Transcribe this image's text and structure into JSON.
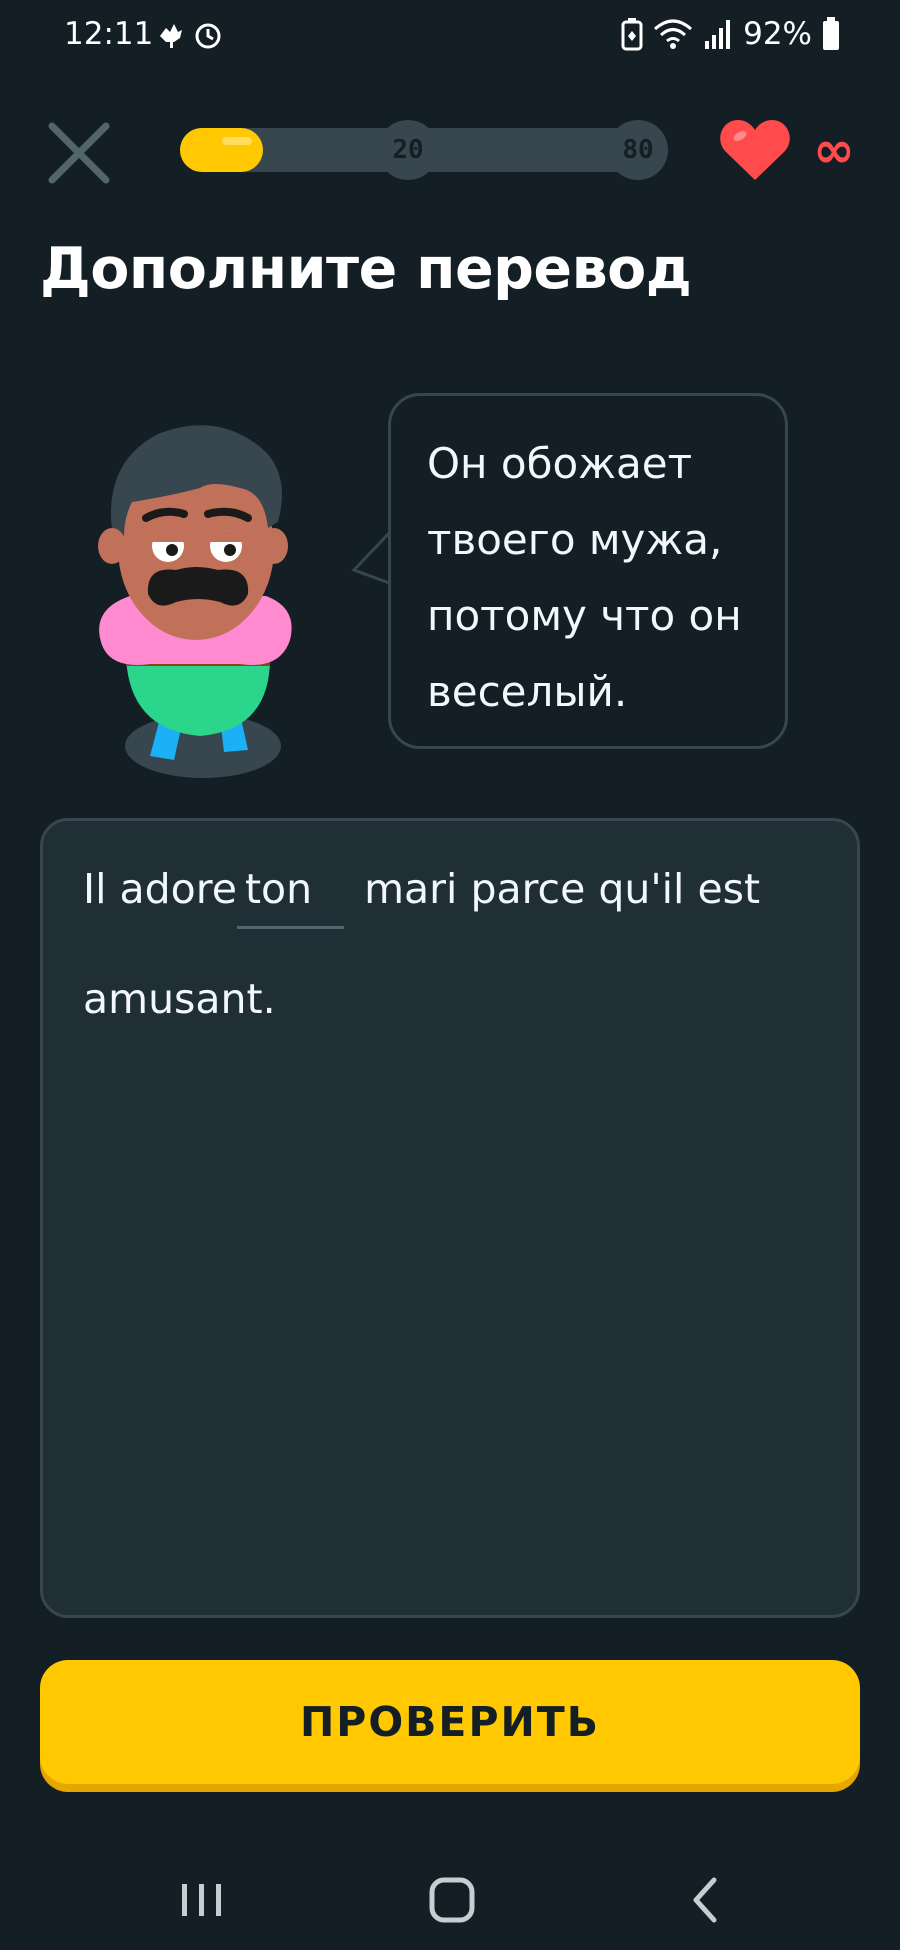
{
  "status_bar": {
    "time": "12:11",
    "battery_percent": "92%",
    "icons": [
      "notification-icon",
      "alarm-icon",
      "battery-saver-icon",
      "wifi-icon",
      "signal-icon",
      "battery-icon"
    ]
  },
  "lesson": {
    "progress_fraction": 0.17,
    "milestones": [
      "20",
      "80"
    ],
    "hearts": "∞",
    "colors": {
      "progress": "#ffc800",
      "heart": "#ff4b4b",
      "button": "#ffc800",
      "background": "#131f24"
    }
  },
  "prompt": {
    "heading": "Дополните перевод",
    "source_sentence": "Он обожает твоего мужа, потому что он веселый."
  },
  "answer": {
    "before_blank": "Il adore",
    "blank_text": "ton",
    "after_blank": "mari parce qu'il est",
    "line2": "amusant."
  },
  "actions": {
    "check_label": "ПРОВЕРИТЬ"
  },
  "nav": {
    "recents": "recents-icon",
    "home": "home-icon",
    "back": "back-icon"
  }
}
